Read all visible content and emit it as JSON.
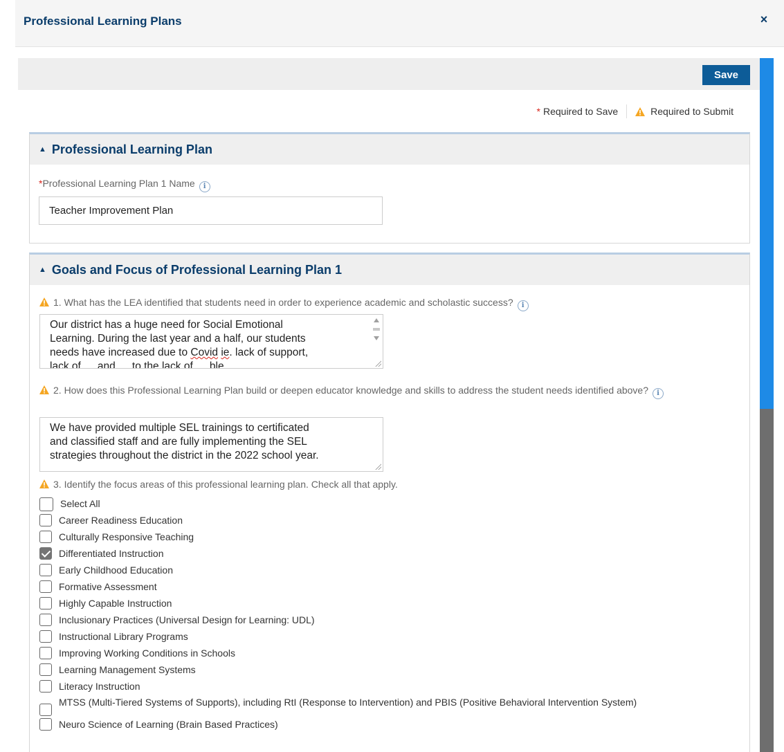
{
  "modal": {
    "title": "Professional Learning Plans",
    "close_label": "×"
  },
  "toolbar": {
    "save_label": "Save"
  },
  "legend": {
    "required_save": "Required to Save",
    "required_submit": "Required to Submit"
  },
  "section1": {
    "title": "Professional Learning Plan",
    "field_label": "Professional Learning Plan 1 Name",
    "field_value": "Teacher Improvement Plan"
  },
  "section2": {
    "title": "Goals and Focus of Professional Learning Plan 1",
    "q1": {
      "label": "1. What has the LEA identified that students need in order to experience academic and scholastic success?",
      "line1": "Our district has a huge need for Social Emotional",
      "line2": "Learning.  During the last year and a half, our students",
      "line3_a": "needs have increased due to ",
      "line3_w1": "Covid",
      "line3_sp": " ",
      "line3_w2": "ie",
      "line3_b": ". lack of support,",
      "line4": "lack of … and … to the lack of … ble …"
    },
    "q2": {
      "label": "2. How does this Professional Learning Plan build or deepen educator knowledge and skills to address the student needs identified above?",
      "line1": "We have provided multiple SEL trainings to certificated",
      "line2": "and classified staff and are fully implementing the SEL",
      "line3": "strategies throughout the district in the 2022 school year."
    },
    "q3": {
      "label": "3. Identify the focus areas of this professional learning plan. Check all that apply.",
      "options": [
        {
          "label": "Select All",
          "checked": false
        },
        {
          "label": "Career Readiness Education",
          "checked": false
        },
        {
          "label": "Culturally Responsive Teaching",
          "checked": false
        },
        {
          "label": "Differentiated Instruction",
          "checked": true
        },
        {
          "label": "Early Childhood Education",
          "checked": false
        },
        {
          "label": "Formative Assessment",
          "checked": false
        },
        {
          "label": "Highly Capable Instruction",
          "checked": false
        },
        {
          "label": "Inclusionary Practices (Universal Design for Learning: UDL)",
          "checked": false
        },
        {
          "label": "Instructional Library Programs",
          "checked": false
        },
        {
          "label": "Improving Working Conditions in Schools",
          "checked": false
        },
        {
          "label": "Learning Management Systems",
          "checked": false
        },
        {
          "label": "Literacy Instruction",
          "checked": false
        },
        {
          "label": "MTSS (Multi-Tiered Systems of Supports), including RtI (Response to Intervention) and PBIS (Positive Behavioral Intervention System)",
          "checked": false
        },
        {
          "label": "Neuro Science of Learning (Brain Based Practices)",
          "checked": false
        }
      ]
    }
  },
  "colors": {
    "accent": "#0d5c98",
    "title": "#0b3d6b",
    "required": "#d9251c",
    "warning": "#f5a623",
    "scroll_thumb": "#1e8ae6"
  },
  "scroll": {
    "fraction_visible": 0.5
  }
}
